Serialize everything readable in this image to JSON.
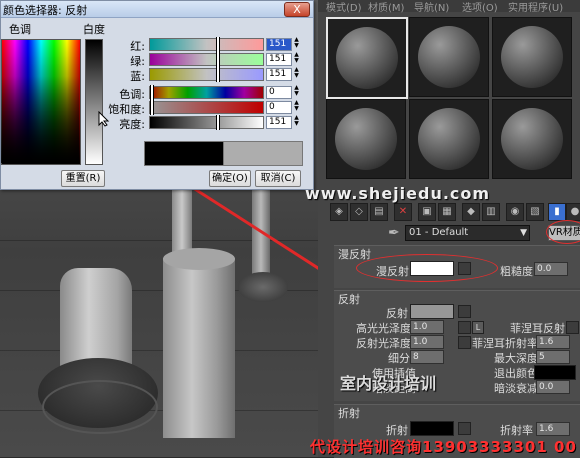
{
  "dialog": {
    "title": "颜色选择器: 反射",
    "close_label": "X",
    "hue_label": "色调",
    "whiteness_label": "白度",
    "rgb_sliders": [
      {
        "label": "红:",
        "value": "151",
        "selected": true
      },
      {
        "label": "绿:",
        "value": "151",
        "selected": false
      },
      {
        "label": "蓝:",
        "value": "151",
        "selected": false
      }
    ],
    "hsv_sliders": [
      {
        "label": "色调:",
        "value": "0"
      },
      {
        "label": "饱和度:",
        "value": "0"
      },
      {
        "label": "亮度:",
        "value": "151"
      }
    ],
    "reset_button": "重置(R)",
    "ok_button": "确定(O)",
    "cancel_button": "取消(C)",
    "new_color": "#979797"
  },
  "material_editor": {
    "menu": [
      "模式(D)",
      "材质(M)",
      "导航(N)",
      "选项(O)",
      "实用程序(U)"
    ],
    "material_name": "01 - Default",
    "material_type": "VR材质",
    "diffuse": {
      "section_title": "漫反射",
      "diffuse_label": "漫反射",
      "roughness_label": "粗糙度",
      "roughness_value": "0.0"
    },
    "reflection": {
      "section_title": "反射",
      "reflect_label": "反射",
      "hilight_gloss_label": "高光光泽度",
      "hilight_gloss_value": "1.0",
      "lock_label": "L",
      "fresnel_label": "菲涅耳反射",
      "refl_gloss_label": "反射光泽度",
      "refl_gloss_value": "1.0",
      "fresnel_ior_label": "菲涅耳折射率",
      "fresnel_ior_value": "1.6",
      "subdivs_label": "细分",
      "subdivs_value": "8",
      "max_depth_label": "最大深度",
      "max_depth_value": "5",
      "use_interp_label": "使用插值",
      "exit_color_label": "退出颜色",
      "dim_distance_label": "暗淡距离",
      "dim_falloff_label": "暗淡衰减",
      "dim_falloff_value": "0.0"
    },
    "refraction": {
      "section_title": "折射",
      "refract_label": "折射",
      "ior_label": "折射率",
      "ior_value": "1.6"
    }
  },
  "watermarks": {
    "site": "www.shejiedu.com",
    "course": "室内设计培训",
    "footer": "代设计培训咨询13903333301 00"
  }
}
